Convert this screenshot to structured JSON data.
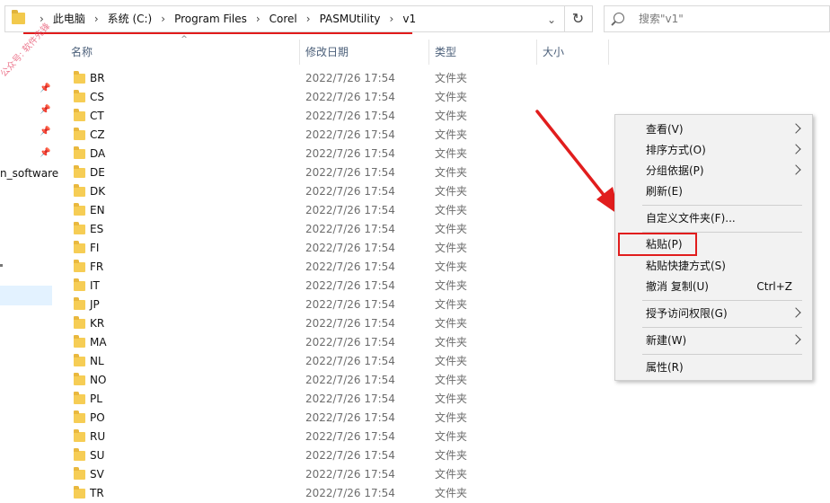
{
  "address": {
    "crumbs": [
      "此电脑",
      "系统 (C:)",
      "Program Files",
      "Corel",
      "PASMUtility",
      "v1"
    ],
    "separator": "›"
  },
  "search": {
    "placeholder": "搜索\"v1\""
  },
  "nav": {
    "partial_item": "n_software"
  },
  "watermark": "公众号: 软件先锋",
  "columns": {
    "name": "名称",
    "date": "修改日期",
    "type": "类型",
    "size": "大小"
  },
  "rows": [
    {
      "name": "BR",
      "date": "2022/7/26 17:54",
      "type": "文件夹"
    },
    {
      "name": "CS",
      "date": "2022/7/26 17:54",
      "type": "文件夹"
    },
    {
      "name": "CT",
      "date": "2022/7/26 17:54",
      "type": "文件夹"
    },
    {
      "name": "CZ",
      "date": "2022/7/26 17:54",
      "type": "文件夹"
    },
    {
      "name": "DA",
      "date": "2022/7/26 17:54",
      "type": "文件夹"
    },
    {
      "name": "DE",
      "date": "2022/7/26 17:54",
      "type": "文件夹"
    },
    {
      "name": "DK",
      "date": "2022/7/26 17:54",
      "type": "文件夹"
    },
    {
      "name": "EN",
      "date": "2022/7/26 17:54",
      "type": "文件夹"
    },
    {
      "name": "ES",
      "date": "2022/7/26 17:54",
      "type": "文件夹"
    },
    {
      "name": "FI",
      "date": "2022/7/26 17:54",
      "type": "文件夹"
    },
    {
      "name": "FR",
      "date": "2022/7/26 17:54",
      "type": "文件夹"
    },
    {
      "name": "IT",
      "date": "2022/7/26 17:54",
      "type": "文件夹"
    },
    {
      "name": "JP",
      "date": "2022/7/26 17:54",
      "type": "文件夹"
    },
    {
      "name": "KR",
      "date": "2022/7/26 17:54",
      "type": "文件夹"
    },
    {
      "name": "MA",
      "date": "2022/7/26 17:54",
      "type": "文件夹"
    },
    {
      "name": "NL",
      "date": "2022/7/26 17:54",
      "type": "文件夹"
    },
    {
      "name": "NO",
      "date": "2022/7/26 17:54",
      "type": "文件夹"
    },
    {
      "name": "PL",
      "date": "2022/7/26 17:54",
      "type": "文件夹"
    },
    {
      "name": "PO",
      "date": "2022/7/26 17:54",
      "type": "文件夹"
    },
    {
      "name": "RU",
      "date": "2022/7/26 17:54",
      "type": "文件夹"
    },
    {
      "name": "SU",
      "date": "2022/7/26 17:54",
      "type": "文件夹"
    },
    {
      "name": "SV",
      "date": "2022/7/26 17:54",
      "type": "文件夹"
    },
    {
      "name": "TR",
      "date": "2022/7/26 17:54",
      "type": "文件夹"
    }
  ],
  "context_menu": {
    "view": "查看(V)",
    "sort": "排序方式(O)",
    "group": "分组依据(P)",
    "refresh": "刷新(E)",
    "customize": "自定义文件夹(F)...",
    "paste": "粘贴(P)",
    "paste_shortcut": "粘贴快捷方式(S)",
    "undo": "撤消 复制(U)",
    "undo_shortcut": "Ctrl+Z",
    "grant_access": "授予访问权限(G)",
    "new": "新建(W)",
    "properties": "属性(R)"
  },
  "colors": {
    "highlight": "#e11d1d",
    "folder": "#f6cd55",
    "menu_bg": "#f2f2f2"
  }
}
